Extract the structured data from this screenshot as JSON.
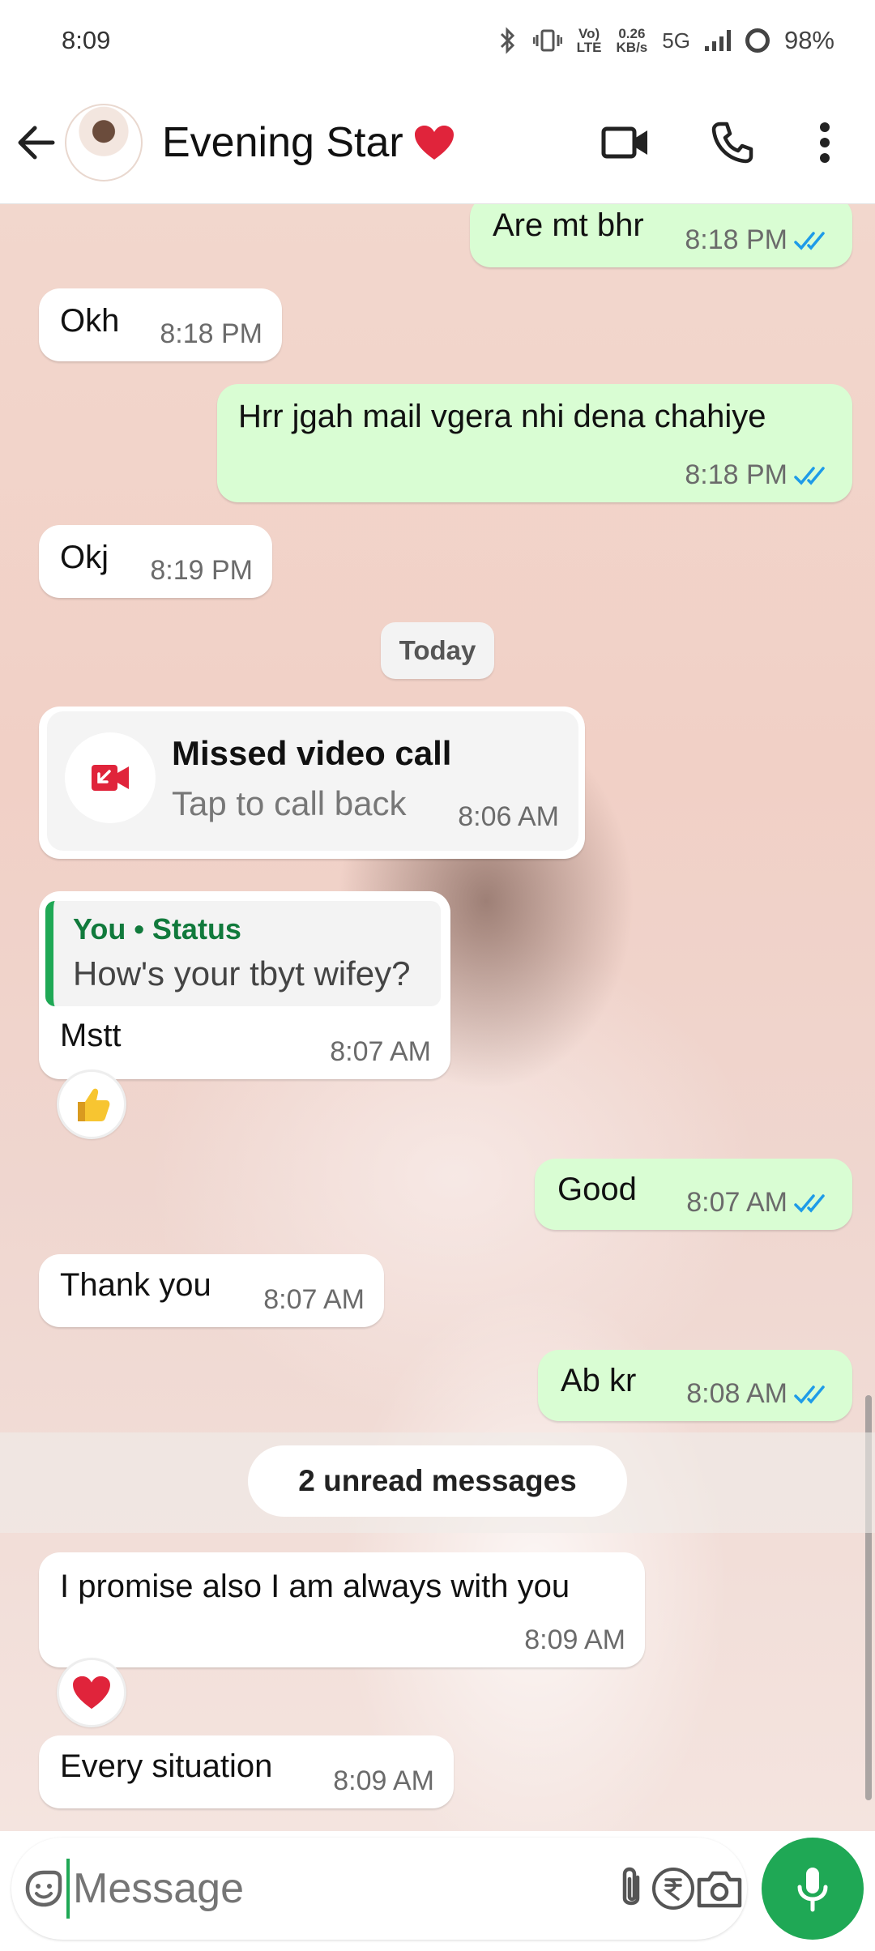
{
  "status_bar": {
    "time": "8:09",
    "net_speed_top": "0.26",
    "net_speed_bottom": "KB/s",
    "network": "5G",
    "battery": "98%"
  },
  "header": {
    "contact_name": "Evening Star"
  },
  "messages": [
    {
      "dir": "out",
      "text": "Are mt bhr",
      "time": "8:18 PM",
      "read": true
    },
    {
      "dir": "in",
      "text": "Okh",
      "time": "8:18 PM"
    },
    {
      "dir": "out",
      "text": "Hrr jgah mail vgera nhi dena chahiye",
      "time": "8:18 PM",
      "read": true
    },
    {
      "dir": "in",
      "text": "Okj",
      "time": "8:19 PM"
    },
    {
      "dir": "in",
      "text": "Mstt",
      "time": "8:07 AM"
    },
    {
      "dir": "out",
      "text": "Good",
      "time": "8:07 AM",
      "read": true
    },
    {
      "dir": "in",
      "text": "Thank you",
      "time": "8:07 AM"
    },
    {
      "dir": "out",
      "text": "Ab kr",
      "time": "8:08 AM",
      "read": true
    },
    {
      "dir": "in",
      "text": "I promise also I am always with you",
      "time": "8:09 AM"
    },
    {
      "dir": "in",
      "text": "Every situation",
      "time": "8:09 AM"
    }
  ],
  "date_chip": "Today",
  "missed_call": {
    "title": "Missed video call",
    "subtitle": "Tap to call back",
    "time": "8:06 AM"
  },
  "quoted_status": {
    "who": "You • Status",
    "text": "How's your tbyt wifey?"
  },
  "unread_label": "2 unread messages",
  "reactions": {
    "mstt": "thumbs-up",
    "promise": "red-heart"
  },
  "input": {
    "placeholder": "Message"
  },
  "colors": {
    "accent_green": "#1fa855",
    "outgoing_bubble": "#d9fdd3",
    "read_ticks": "#1e9be8",
    "missed_call_red": "#e0243b"
  }
}
